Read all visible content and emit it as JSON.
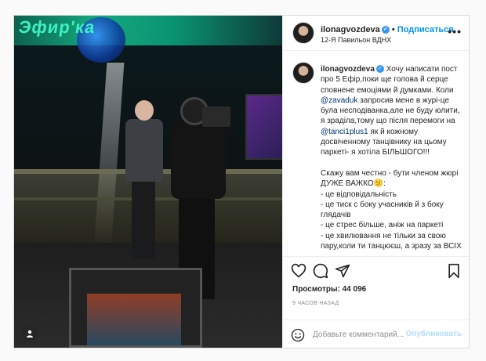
{
  "post": {
    "media": {
      "neon_sign": "Эфир'ка",
      "user_tag_icon": "person-icon"
    },
    "header": {
      "username": "ilonagvozdeva",
      "separator": "•",
      "follow_label": "Подписаться",
      "location": "12-Я Павильон ВДНХ",
      "more_label": "•••"
    },
    "caption": {
      "username": "ilonagvozdeva",
      "lines": [
        {
          "t": "Хочу написати пост про 5 Ефір,поки ще голова й серце сповнене емоціями й думками. Коли "
        },
        {
          "m": "@zavaduk"
        },
        {
          "t": " запросив мене в журі-це була несподіванка,але не буду юлити, я зраділа,тому що після перемоги на "
        },
        {
          "m": "@tanci1plus1"
        },
        {
          "t": " як й кожному досвіченному танцівнику на цьому паркеті- я хотіла БІЛЬШОГО!!!\n\nСкажу вам честно - бути членом жюрі ДУЖЕ ВАЖКО😕:\n- це відповідальність\n- це тиск с боку учасників й з боку глядачів\n- це стрес більше, аніж на паркеті\n- це хвилювання не тільки за свою пару,коли ти танцюєш, а зразу за ВСІХ"
        }
      ]
    },
    "stats": {
      "views": "Просмотры: 44 096",
      "time": "9 ЧАСОВ НАЗАД"
    },
    "comment": {
      "placeholder": "Добавьте комментарий...",
      "publish_label": "Опубликовать"
    }
  }
}
